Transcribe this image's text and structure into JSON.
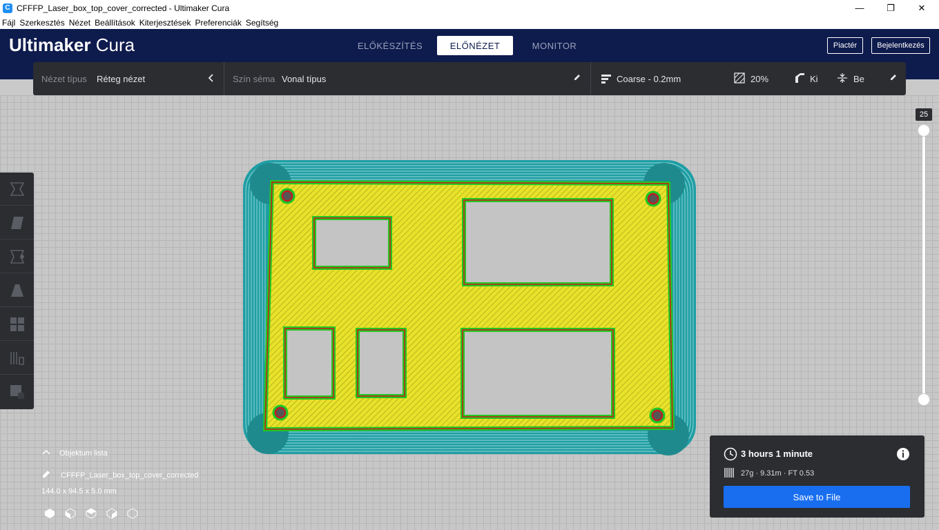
{
  "window": {
    "title": "CFFFP_Laser_box_top_cover_corrected - Ultimaker Cura",
    "icon": "cura-app-icon"
  },
  "menu": [
    "Fájl",
    "Szerkesztés",
    "Nézet",
    "Beállítások",
    "Kiterjesztések",
    "Preferenciák",
    "Segítség"
  ],
  "header": {
    "logo_brand": "Ultimaker",
    "logo_product": "Cura",
    "tabs": [
      "ELŐKÉSZÍTÉS",
      "ELŐNÉZET",
      "MONITOR"
    ],
    "active_tab": "ELŐNÉZET",
    "marketplace": "Piactér",
    "login": "Bejelentkezés"
  },
  "toolbar": {
    "view_type_label": "Nézet típus",
    "view_type_value": "Réteg nézet",
    "color_scheme_label": "Szín séma",
    "color_scheme_value": "Vonal típus",
    "profile": "Coarse - 0.2mm",
    "infill": "20%",
    "support": "Ki",
    "adhesion": "Be"
  },
  "layer_slider": {
    "value": "25"
  },
  "object_list": {
    "header": "Objektum lista",
    "object_name": "CFFFP_Laser_box_top_cover_corrected",
    "dimensions": "144.0 x 94.5 x 5.0 mm"
  },
  "print_info": {
    "time": "3 hours 1 minute",
    "material": "27g · 9.31m · FT 0.53",
    "save_label": "Save to File"
  },
  "colors": {
    "header_bg": "#0e1b4d",
    "panel_bg": "#2b2d31",
    "skirt": "#1f9ea4",
    "infill": "#e8e22a",
    "wall_outer": "#d01818",
    "wall_inner": "#22c822",
    "button_blue": "#196ef0"
  }
}
